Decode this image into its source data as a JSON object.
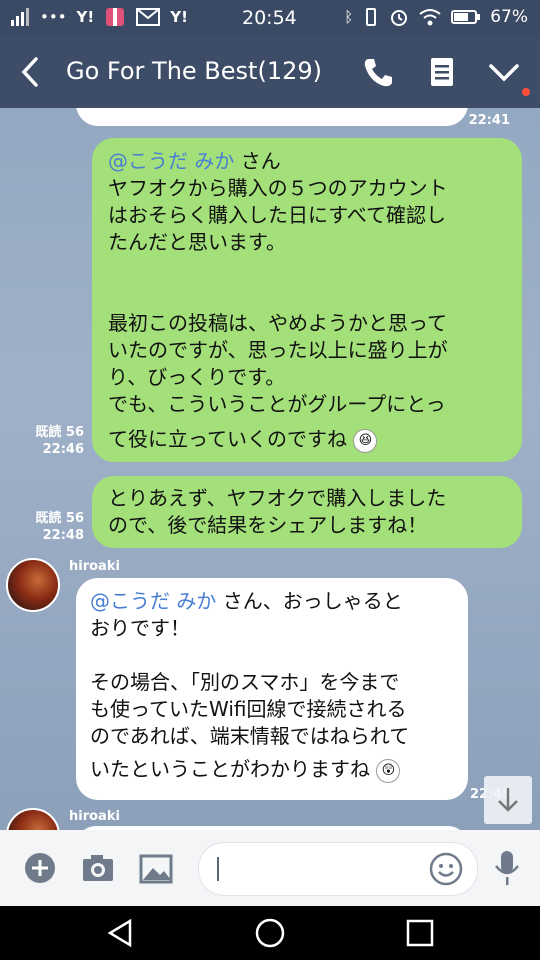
{
  "status": {
    "time": "20:54",
    "battery": "67%",
    "left_icons": [
      "signal-icon",
      "more-dots-icon",
      "yahoo-icon",
      "gift-icon",
      "mail-icon",
      "yahoo-icon"
    ],
    "right_icons": [
      "bluetooth-icon",
      "vibrate-icon",
      "alarm-icon",
      "wifi-icon",
      "battery-icon"
    ]
  },
  "header": {
    "title": "Go For The Best(129)"
  },
  "messages": {
    "m0": {
      "time": "22:41"
    },
    "m1": {
      "mention": "@こうだ みか",
      "suffix": " さん",
      "lines": [
        "ヤフオクから購入の５つのアカウント",
        "はおそらく購入した日にすべて確認し",
        "たんだと思います。",
        "",
        "",
        "最初この投稿は、やめようかと思って",
        "いたのですが、思った以上に盛り上が",
        "り、びっくりです。",
        "でも、こういうことがグループにとっ",
        "て役に立っていくのですね"
      ],
      "read": "既読 56",
      "time": "22:46"
    },
    "m2": {
      "lines": [
        "とりあえず、ヤフオクで購入しました",
        "ので、後で結果をシェアしますね！"
      ],
      "read": "既読 56",
      "time": "22:48"
    },
    "m3": {
      "sender": "hiroaki",
      "mention": "@こうだ みか",
      "suffix": " さん、おっしゃると",
      "lines": [
        "おりです！",
        "",
        "その場合、「別のスマホ」を今まで",
        "も使っていたWifi回線で接続される",
        "のであれば、端末情報ではねられて",
        "いたということがわかりますね"
      ],
      "time": "22:49"
    },
    "m4": {
      "sender": "hiroaki"
    }
  },
  "colors": {
    "header": "#3e4d67",
    "my_bubble": "#a3e079",
    "their_bubble": "#ffffff",
    "mention": "#4a7fd3"
  }
}
